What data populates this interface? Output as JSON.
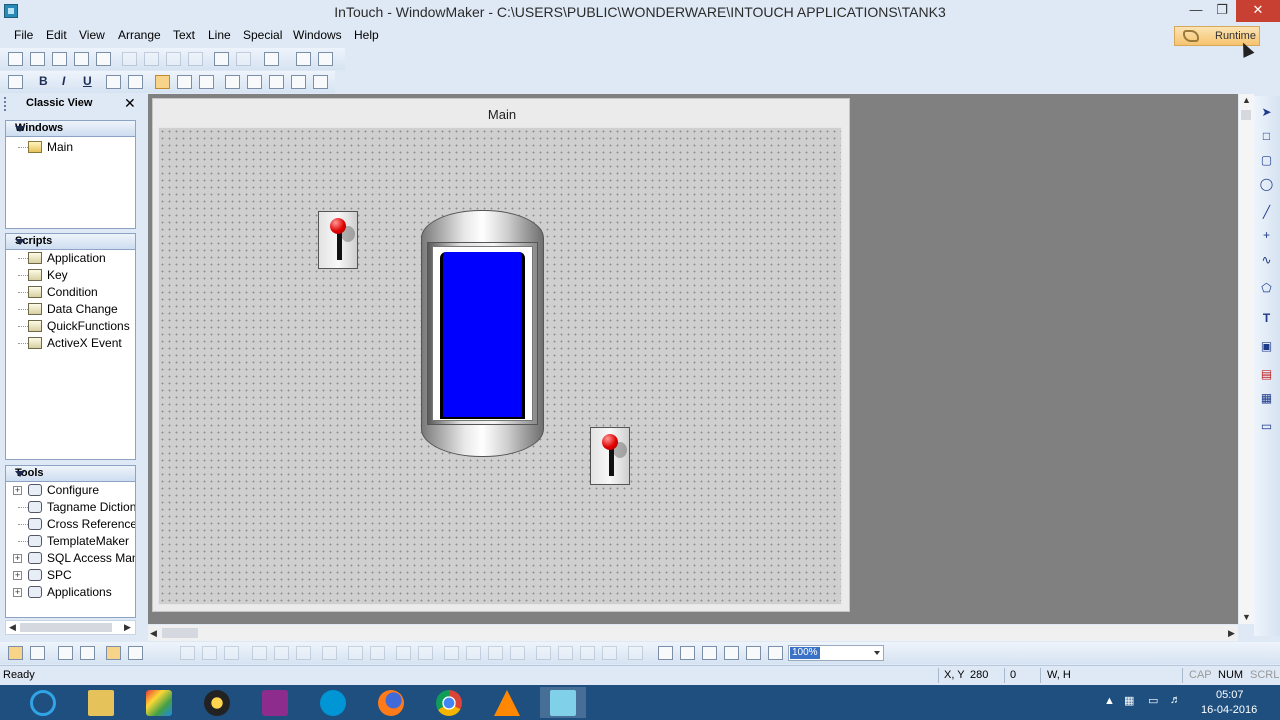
{
  "window": {
    "title": "InTouch - WindowMaker - C:\\USERS\\PUBLIC\\WONDERWARE\\INTOUCH APPLICATIONS\\TANK3",
    "minimize": "—",
    "restore": "❐",
    "close": "✕"
  },
  "menu": [
    "File",
    "Edit",
    "View",
    "Arrange",
    "Text",
    "Line",
    "Special",
    "Windows",
    "Help"
  ],
  "runtime_label": "Runtime",
  "format_toolbar": {
    "bold": "B",
    "italic": "I",
    "underline": "U"
  },
  "classic_view": {
    "title": "Classic View",
    "close": "✕",
    "windows": {
      "header": "Windows",
      "items": [
        "Main"
      ]
    },
    "scripts": {
      "header": "Scripts",
      "items": [
        "Application",
        "Key",
        "Condition",
        "Data Change",
        "QuickFunctions",
        "ActiveX Event"
      ]
    },
    "tools": {
      "header": "Tools",
      "items": [
        "Configure",
        "Tagname Dictiona",
        "Cross Reference",
        "TemplateMaker",
        "SQL Access Mana",
        "SPC",
        "Applications"
      ]
    }
  },
  "canvas": {
    "window_title": "Main",
    "tank_level_fraction": 0.95
  },
  "zoom_value": "100%",
  "status": {
    "ready": "Ready",
    "xy_label": "X, Y",
    "x": "280",
    "y": "0",
    "wh_label": "W, H",
    "cap": "CAP",
    "num": "NUM",
    "scrl": "SCRL"
  },
  "clock": {
    "time": "05:07",
    "date": "16-04-2016"
  },
  "colors": {
    "tank_liquid": "#0000ff",
    "switch_knob": "#e00000",
    "workspace": "#808080",
    "taskbar": "#1e4f7f"
  }
}
